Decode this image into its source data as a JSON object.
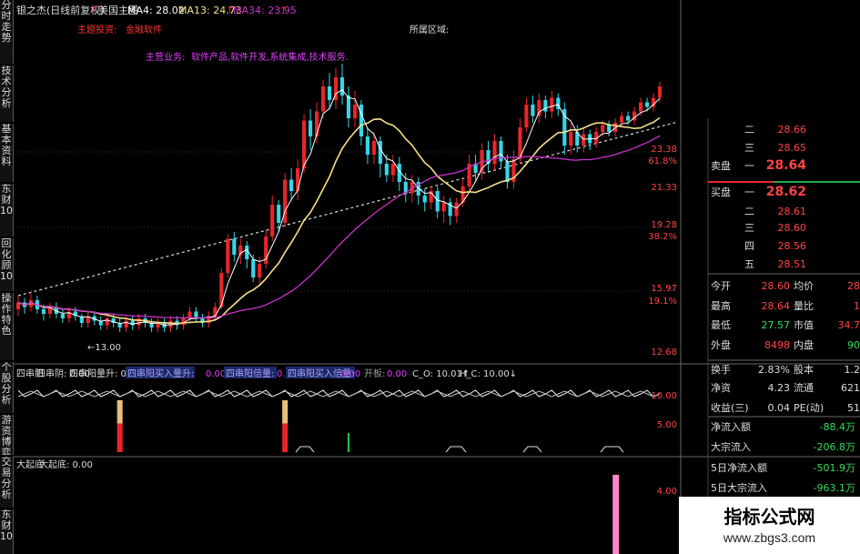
{
  "colors": {
    "up": "#e8262a",
    "down": "#35d6e8",
    "ma4": "#ffffff",
    "ma13": "#f5e18a",
    "ma34": "#cc33cc",
    "label_red": "#ff3333",
    "label_magenta": "#e040fb",
    "pink": "#ff88cc",
    "green": "#22cc44",
    "gold": "#e8c07a"
  },
  "header": {
    "stock_name": "银之杰(日线前复权)",
    "chart_label": "美国主图",
    "ma4_label": "MA4: 28.02",
    "ma13_label": "MA13: 24.73",
    "ma34_label": "MA34: 23.95",
    "concept_label": "主题投资:",
    "concept_value": "金融软件",
    "region_label": "所属区域:",
    "business_label": "主营业务:",
    "business_value": "软件产品,软件开发,系统集成,技术服务."
  },
  "price_axis": {
    "labels": [
      "23.38",
      "61.8%",
      "21.33",
      "19.28",
      "38.2%",
      "15.97",
      "19.1%",
      "12.68"
    ]
  },
  "annotations": {
    "low_label": "←13.00"
  },
  "sidebar_tabs": [
    "分时走势",
    "技术分析",
    "基本资料",
    "东财10",
    "回化顾10",
    "操作特色",
    "个股分析",
    "游资博弈",
    "交易分析",
    "东财10"
  ],
  "indicator1": {
    "legend": [
      {
        "text": "四串阳",
        "style": "white"
      },
      {
        "text": "四串阴: 0.00",
        "style": "white"
      },
      {
        "text": "四串阳量升: 0.00",
        "style": "white"
      },
      {
        "text": "四串阳买入量升:",
        "style": "boxed"
      },
      {
        "text": "0.00",
        "style": "magenta"
      },
      {
        "text": "四串阳倍量:",
        "style": "boxed"
      },
      {
        "text": "0.00",
        "style": "magenta"
      },
      {
        "text": "四串阳买入倍量:",
        "style": "boxed"
      },
      {
        "text": "0.00",
        "style": "magenta"
      },
      {
        "text": "开板:",
        "style": "gray"
      },
      {
        "text": "0.00",
        "style": "magenta"
      },
      {
        "text": "C_O: 10.01↑",
        "style": "white"
      },
      {
        "text": "H_C: 10.00↓",
        "style": "white"
      }
    ],
    "axis_labels": [
      "10.00",
      "5.00"
    ]
  },
  "indicator2": {
    "name": "大起底",
    "value_label": "大起底: 0.00",
    "axis_label": "4.00"
  },
  "order_book": {
    "sell": [
      {
        "label": "二",
        "price": "28.66"
      },
      {
        "label": "三",
        "price": "28.65"
      },
      {
        "label": "一",
        "price": "28.64",
        "side": "卖盘"
      }
    ],
    "buy": [
      {
        "label": "一",
        "price": "28.62",
        "side": "买盘"
      },
      {
        "label": "二",
        "price": "28.61"
      },
      {
        "label": "三",
        "price": "28.60"
      },
      {
        "label": "四",
        "price": "28.56"
      },
      {
        "label": "五",
        "price": "28.51"
      }
    ]
  },
  "quote_stats": [
    {
      "k1": "今开",
      "v1": "28.60",
      "k2": "均价",
      "v2": "28"
    },
    {
      "k1": "最高",
      "v1": "28.64",
      "k2": "量比",
      "v2": "1"
    },
    {
      "k1": "最低",
      "v1": "27.57",
      "k2": "市值",
      "v2": "34.7"
    },
    {
      "k1": "外盘",
      "v1": "8498",
      "k2": "内盘",
      "v2": "90"
    }
  ],
  "fund_stats": [
    {
      "k1": "换手",
      "v1": "2.83%",
      "k2": "股本",
      "v2": "1.2"
    },
    {
      "k1": "净资",
      "v1": "4.23",
      "k2": "流通",
      "v2": "621"
    },
    {
      "k1": "收益(三)",
      "v1": "0.04",
      "k2": "PE(动)",
      "v2": "51"
    }
  ],
  "flow_stats": [
    {
      "k": "净流入额",
      "v": "-88.4万"
    },
    {
      "k": "大宗流入",
      "v": "-206.8万"
    },
    {
      "k": "5日净流入额",
      "v": "-501.9万"
    },
    {
      "k": "5日大宗流入",
      "v": "-963.1万"
    }
  ],
  "watermark": {
    "title": "指标公式网",
    "url": "www.zbgs3.com"
  },
  "chart_data": {
    "type": "candlestick",
    "ylim": [
      12.0,
      25.0
    ],
    "candles": [
      {
        "o": 14.2,
        "c": 14.5,
        "h": 14.8,
        "l": 13.9
      },
      {
        "o": 14.5,
        "c": 14.3,
        "h": 14.7,
        "l": 14.0
      },
      {
        "o": 14.3,
        "c": 14.6,
        "h": 14.9,
        "l": 14.1
      },
      {
        "o": 14.6,
        "c": 14.2,
        "h": 14.8,
        "l": 14.0
      },
      {
        "o": 14.2,
        "c": 14.0,
        "h": 14.4,
        "l": 13.7
      },
      {
        "o": 14.0,
        "c": 14.3,
        "h": 14.5,
        "l": 13.8
      },
      {
        "o": 14.3,
        "c": 14.0,
        "h": 14.5,
        "l": 13.8
      },
      {
        "o": 14.0,
        "c": 13.8,
        "h": 14.2,
        "l": 13.6
      },
      {
        "o": 13.8,
        "c": 14.1,
        "h": 14.3,
        "l": 13.6
      },
      {
        "o": 14.1,
        "c": 13.9,
        "h": 14.3,
        "l": 13.7
      },
      {
        "o": 13.9,
        "c": 13.6,
        "h": 14.0,
        "l": 13.4
      },
      {
        "o": 13.6,
        "c": 13.9,
        "h": 14.1,
        "l": 13.4
      },
      {
        "o": 13.9,
        "c": 13.7,
        "h": 14.1,
        "l": 13.5
      },
      {
        "o": 13.7,
        "c": 13.5,
        "h": 13.9,
        "l": 13.3
      },
      {
        "o": 13.5,
        "c": 13.8,
        "h": 14.0,
        "l": 13.3
      },
      {
        "o": 13.8,
        "c": 13.6,
        "h": 14.0,
        "l": 13.4
      },
      {
        "o": 13.6,
        "c": 13.4,
        "h": 13.8,
        "l": 13.2
      },
      {
        "o": 13.4,
        "c": 13.7,
        "h": 13.9,
        "l": 13.2
      },
      {
        "o": 13.7,
        "c": 13.5,
        "h": 13.9,
        "l": 13.3
      },
      {
        "o": 13.5,
        "c": 13.8,
        "h": 14.0,
        "l": 13.3
      },
      {
        "o": 13.8,
        "c": 13.6,
        "h": 14.0,
        "l": 13.4
      },
      {
        "o": 13.6,
        "c": 13.4,
        "h": 13.8,
        "l": 13.2
      },
      {
        "o": 13.4,
        "c": 13.6,
        "h": 13.8,
        "l": 13.2
      },
      {
        "o": 13.6,
        "c": 13.4,
        "h": 13.8,
        "l": 13.2
      },
      {
        "o": 13.4,
        "c": 13.7,
        "h": 13.9,
        "l": 13.2
      },
      {
        "o": 13.7,
        "c": 13.5,
        "h": 13.9,
        "l": 13.3
      },
      {
        "o": 13.5,
        "c": 13.8,
        "h": 14.0,
        "l": 13.3
      },
      {
        "o": 13.8,
        "c": 14.1,
        "h": 14.3,
        "l": 13.6
      },
      {
        "o": 14.1,
        "c": 13.8,
        "h": 14.3,
        "l": 13.6
      },
      {
        "o": 13.8,
        "c": 13.6,
        "h": 14.0,
        "l": 13.4
      },
      {
        "o": 13.6,
        "c": 13.9,
        "h": 14.1,
        "l": 13.4
      },
      {
        "o": 13.9,
        "c": 14.3,
        "h": 14.5,
        "l": 13.7
      },
      {
        "o": 14.3,
        "c": 15.8,
        "h": 16.0,
        "l": 14.2
      },
      {
        "o": 15.8,
        "c": 17.3,
        "h": 17.5,
        "l": 15.6
      },
      {
        "o": 17.3,
        "c": 16.6,
        "h": 17.6,
        "l": 16.3
      },
      {
        "o": 16.6,
        "c": 17.0,
        "h": 17.3,
        "l": 16.2
      },
      {
        "o": 17.0,
        "c": 16.4,
        "h": 17.2,
        "l": 16.0
      },
      {
        "o": 16.4,
        "c": 15.6,
        "h": 16.6,
        "l": 15.4
      },
      {
        "o": 15.6,
        "c": 16.2,
        "h": 16.5,
        "l": 15.3
      },
      {
        "o": 16.2,
        "c": 17.4,
        "h": 17.7,
        "l": 16.0
      },
      {
        "o": 17.4,
        "c": 18.8,
        "h": 19.2,
        "l": 17.2
      },
      {
        "o": 18.8,
        "c": 18.0,
        "h": 19.0,
        "l": 17.6
      },
      {
        "o": 18.0,
        "c": 19.9,
        "h": 20.2,
        "l": 17.8
      },
      {
        "o": 19.9,
        "c": 19.4,
        "h": 20.4,
        "l": 19.0
      },
      {
        "o": 19.4,
        "c": 20.4,
        "h": 20.8,
        "l": 19.0
      },
      {
        "o": 20.4,
        "c": 22.5,
        "h": 22.8,
        "l": 20.2
      },
      {
        "o": 22.5,
        "c": 21.8,
        "h": 23.0,
        "l": 21.2
      },
      {
        "o": 21.8,
        "c": 22.9,
        "h": 23.3,
        "l": 21.5
      },
      {
        "o": 22.9,
        "c": 24.0,
        "h": 24.3,
        "l": 22.6
      },
      {
        "o": 24.0,
        "c": 23.4,
        "h": 24.6,
        "l": 23.0
      },
      {
        "o": 23.4,
        "c": 24.4,
        "h": 24.8,
        "l": 23.0
      },
      {
        "o": 24.4,
        "c": 23.6,
        "h": 25.0,
        "l": 23.2
      },
      {
        "o": 23.6,
        "c": 22.6,
        "h": 24.0,
        "l": 22.2
      },
      {
        "o": 22.6,
        "c": 23.2,
        "h": 23.8,
        "l": 22.2
      },
      {
        "o": 23.2,
        "c": 21.8,
        "h": 23.4,
        "l": 21.4
      },
      {
        "o": 21.8,
        "c": 21.0,
        "h": 22.2,
        "l": 20.6
      },
      {
        "o": 21.0,
        "c": 21.6,
        "h": 22.0,
        "l": 20.6
      },
      {
        "o": 21.6,
        "c": 20.6,
        "h": 21.8,
        "l": 20.0
      },
      {
        "o": 20.6,
        "c": 20.1,
        "h": 21.0,
        "l": 19.8
      },
      {
        "o": 20.1,
        "c": 20.6,
        "h": 21.0,
        "l": 19.8
      },
      {
        "o": 20.6,
        "c": 19.8,
        "h": 20.9,
        "l": 19.4
      },
      {
        "o": 19.8,
        "c": 19.3,
        "h": 20.2,
        "l": 18.9
      },
      {
        "o": 19.3,
        "c": 19.8,
        "h": 20.1,
        "l": 18.9
      },
      {
        "o": 19.8,
        "c": 19.2,
        "h": 20.0,
        "l": 18.8
      },
      {
        "o": 19.2,
        "c": 18.9,
        "h": 19.5,
        "l": 18.5
      },
      {
        "o": 18.9,
        "c": 19.4,
        "h": 19.6,
        "l": 18.6
      },
      {
        "o": 19.4,
        "c": 18.5,
        "h": 19.6,
        "l": 18.2
      },
      {
        "o": 18.5,
        "c": 18.9,
        "h": 19.2,
        "l": 18.0
      },
      {
        "o": 18.9,
        "c": 18.3,
        "h": 19.1,
        "l": 17.9
      },
      {
        "o": 18.3,
        "c": 18.9,
        "h": 19.1,
        "l": 18.0
      },
      {
        "o": 18.9,
        "c": 19.6,
        "h": 19.9,
        "l": 18.7
      },
      {
        "o": 19.6,
        "c": 20.6,
        "h": 21.0,
        "l": 19.4
      },
      {
        "o": 20.6,
        "c": 20.2,
        "h": 21.0,
        "l": 19.8
      },
      {
        "o": 20.2,
        "c": 21.2,
        "h": 21.5,
        "l": 19.9
      },
      {
        "o": 21.2,
        "c": 20.6,
        "h": 21.6,
        "l": 20.2
      },
      {
        "o": 20.6,
        "c": 21.6,
        "h": 21.9,
        "l": 20.3
      },
      {
        "o": 21.6,
        "c": 20.7,
        "h": 21.8,
        "l": 20.4
      },
      {
        "o": 20.7,
        "c": 19.8,
        "h": 21.0,
        "l": 19.5
      },
      {
        "o": 19.8,
        "c": 20.8,
        "h": 21.2,
        "l": 19.5
      },
      {
        "o": 20.8,
        "c": 22.2,
        "h": 22.6,
        "l": 20.6
      },
      {
        "o": 22.2,
        "c": 23.2,
        "h": 23.5,
        "l": 22.0
      },
      {
        "o": 23.2,
        "c": 22.7,
        "h": 23.6,
        "l": 22.4
      },
      {
        "o": 22.7,
        "c": 23.4,
        "h": 23.7,
        "l": 22.4
      },
      {
        "o": 23.4,
        "c": 22.9,
        "h": 23.6,
        "l": 22.6
      },
      {
        "o": 22.9,
        "c": 23.5,
        "h": 23.8,
        "l": 22.6
      },
      {
        "o": 23.5,
        "c": 23.0,
        "h": 23.7,
        "l": 22.7
      },
      {
        "o": 23.0,
        "c": 21.4,
        "h": 23.3,
        "l": 21.0
      },
      {
        "o": 21.4,
        "c": 22.0,
        "h": 22.4,
        "l": 21.0
      },
      {
        "o": 22.0,
        "c": 21.4,
        "h": 22.3,
        "l": 21.1
      },
      {
        "o": 21.4,
        "c": 21.9,
        "h": 22.2,
        "l": 21.1
      },
      {
        "o": 21.9,
        "c": 21.5,
        "h": 22.1,
        "l": 21.2
      },
      {
        "o": 21.5,
        "c": 22.0,
        "h": 22.2,
        "l": 21.3
      },
      {
        "o": 22.0,
        "c": 22.3,
        "h": 22.5,
        "l": 21.8
      },
      {
        "o": 22.3,
        "c": 22.0,
        "h": 22.5,
        "l": 21.8
      },
      {
        "o": 22.0,
        "c": 22.4,
        "h": 22.6,
        "l": 21.8
      },
      {
        "o": 22.4,
        "c": 22.7,
        "h": 22.9,
        "l": 22.2
      },
      {
        "o": 22.7,
        "c": 22.5,
        "h": 22.9,
        "l": 22.3
      },
      {
        "o": 22.5,
        "c": 22.9,
        "h": 23.1,
        "l": 22.3
      },
      {
        "o": 22.9,
        "c": 23.3,
        "h": 23.5,
        "l": 22.7
      },
      {
        "o": 23.3,
        "c": 23.1,
        "h": 23.5,
        "l": 22.9
      },
      {
        "o": 23.1,
        "c": 23.5,
        "h": 23.7,
        "l": 22.9
      },
      {
        "o": 23.5,
        "c": 24.0,
        "h": 24.2,
        "l": 23.3
      }
    ],
    "trendline": [
      {
        "i": 0,
        "p": 14.8
      },
      {
        "i": 106,
        "p": 22.6
      }
    ],
    "indicator1_bars": [
      {
        "i": 16,
        "v": 9.5,
        "c": "red"
      },
      {
        "i": 42,
        "v": 9.5,
        "c": "red"
      },
      {
        "i": 52,
        "v": 3.5,
        "c": "green"
      }
    ],
    "indicator2_bars": [
      {
        "i": 90,
        "v": 6.0
      }
    ]
  }
}
